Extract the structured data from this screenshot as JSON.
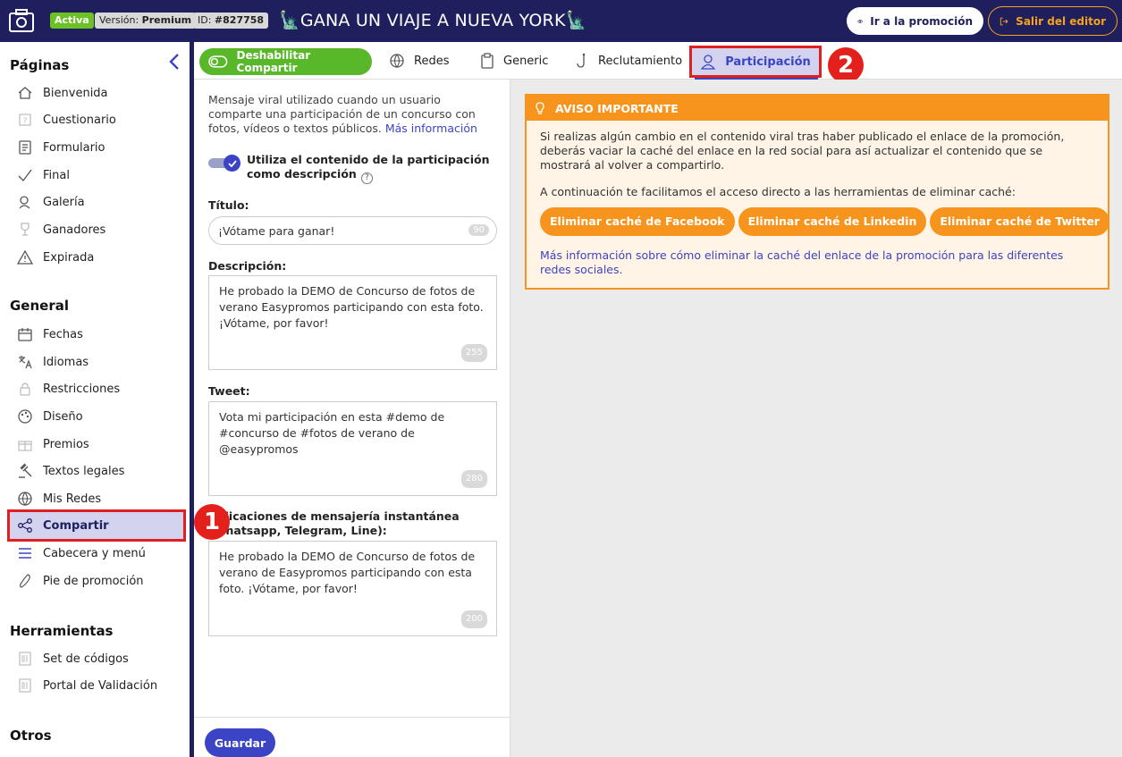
{
  "header": {
    "status_badge": "Activa",
    "version_label": "Versión:",
    "version_value": "Premium",
    "id_label": "ID:",
    "id_value": "#827758",
    "title": "🗽GANA UN VIAJE A NUEVA YORK🗽",
    "promo_button": "Ir a la promoción",
    "exit_button": "Salir del editor",
    "colors": {
      "bar": "#1e1f5c",
      "active_badge": "#6cc225",
      "exit_accent": "#f7a21b"
    }
  },
  "sidebar": {
    "sections": [
      {
        "title": "Páginas",
        "items": [
          {
            "label": "Bienvenida",
            "icon": "home-icon"
          },
          {
            "label": "Cuestionario",
            "icon": "question-icon"
          },
          {
            "label": "Formulario",
            "icon": "form-icon"
          },
          {
            "label": "Final",
            "icon": "check-icon"
          },
          {
            "label": "Galería",
            "icon": "gallery-icon"
          },
          {
            "label": "Ganadores",
            "icon": "trophy-icon"
          },
          {
            "label": "Expirada",
            "icon": "warning-icon"
          }
        ]
      },
      {
        "title": "General",
        "items": [
          {
            "label": "Fechas",
            "icon": "calendar-icon"
          },
          {
            "label": "Idiomas",
            "icon": "translate-icon"
          },
          {
            "label": "Restricciones",
            "icon": "lock-icon"
          },
          {
            "label": "Diseño",
            "icon": "palette-icon"
          },
          {
            "label": "Premios",
            "icon": "gift-icon"
          },
          {
            "label": "Textos legales",
            "icon": "gavel-icon"
          },
          {
            "label": "Mis Redes",
            "icon": "globe-icon"
          },
          {
            "label": "Compartir",
            "icon": "share-icon",
            "active": true
          },
          {
            "label": "Cabecera y menú",
            "icon": "menu-icon"
          },
          {
            "label": "Pie de promoción",
            "icon": "footprint-icon"
          }
        ]
      },
      {
        "title": "Herramientas",
        "items": [
          {
            "label": "Set de códigos",
            "icon": "barcode-icon"
          },
          {
            "label": "Portal de Validación",
            "icon": "barcode-icon"
          }
        ]
      },
      {
        "title": "Otros",
        "items": []
      }
    ]
  },
  "tabs": {
    "disable_button": "Deshabilitar Compartir",
    "items": [
      {
        "label": "Redes",
        "icon": "globe-icon"
      },
      {
        "label": "Generic",
        "icon": "clipboard-icon"
      },
      {
        "label": "Reclutamiento",
        "icon": "hook-icon"
      },
      {
        "label": "Participación",
        "icon": "user-icon",
        "active": true
      }
    ],
    "accent": "#3b44c4"
  },
  "markers": {
    "first": "1",
    "second": "2"
  },
  "form": {
    "intro": "Mensaje viral utilizado cuando un usuario comparte una participación de un concurso con fotos, vídeos o textos públicos.",
    "intro_link": "Más información",
    "toggle_label": "Utiliza el contenido de la participación como descripción",
    "toggle_on": true,
    "title_label": "Título:",
    "title_value": "¡Vótame para ganar!",
    "title_counter": "90",
    "description_label": "Descripción:",
    "description_value": "He probado la DEMO de Concurso de fotos de verano Easypromos participando con esta foto. ¡Vótame, por favor!",
    "description_counter": "255",
    "tweet_label": "Tweet:",
    "tweet_value": "Vota mi participación en esta #demo de #concurso de #fotos de verano de @easypromos",
    "tweet_counter": "280",
    "messaging_label": "Aplicaciones de mensajería instantánea (Whatsapp, Telegram, Line):",
    "messaging_value": "He probado la DEMO de Concurso de fotos de verano de Easypromos participando con esta foto. ¡Vótame, por favor!",
    "messaging_counter": "200",
    "save_button": "Guardar"
  },
  "notice": {
    "title": "AVISO IMPORTANTE",
    "paragraph": "Si realizas algún cambio en el contenido viral tras haber publicado el enlace de la promoción, deberás vaciar la caché del enlace en la red social para así actualizar el contenido que se mostrará al volver a compartirlo.",
    "cache_intro": "A continuación te facilitamos el acceso directo a las herramientas de eliminar caché:",
    "buttons": [
      "Eliminar caché de Facebook",
      "Eliminar caché de Linkedin",
      "Eliminar caché de Twitter"
    ],
    "more_link": "Más información sobre cómo eliminar la caché del enlace de la promoción para las diferentes redes sociales.",
    "accent": "#f7941d"
  }
}
